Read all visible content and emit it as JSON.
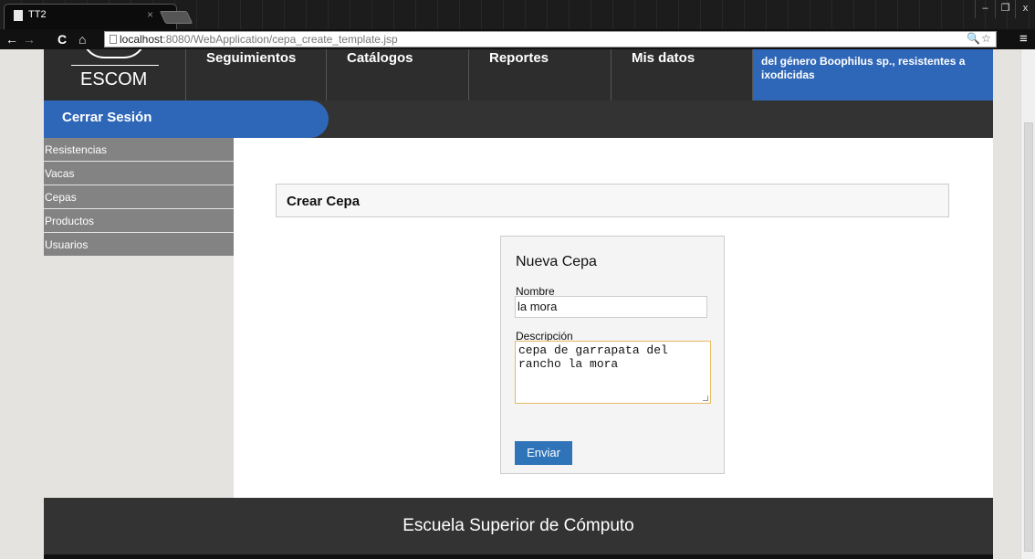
{
  "browser": {
    "tab_title": "TT2",
    "tab_close": "×",
    "url_host": "localhost",
    "url_path": ":8080/WebApplication/cepa_create_template.jsp",
    "back_icon": "←",
    "forward_icon": "→",
    "reload_icon": "C",
    "home_icon": "⌂",
    "zoom_icon": "🔍",
    "star_icon": "☆",
    "menu_icon": "≡",
    "minimize": "–",
    "restore": "❐",
    "close": "x"
  },
  "header": {
    "logo_text": "ESCOM",
    "menu": [
      "Seguimientos",
      "Catálogos",
      "Reportes",
      "Mis datos"
    ],
    "title": "del género Boophilus sp., resistentes a ixodicidas"
  },
  "subbar": {
    "logout_label": "Cerrar Sesión"
  },
  "sidebar": {
    "items": [
      "Resistencias",
      "Vacas",
      "Cepas",
      "Productos",
      "Usuarios"
    ]
  },
  "content": {
    "section_title": "Crear Cepa",
    "form": {
      "title": "Nueva Cepa",
      "nombre_label": "Nombre",
      "nombre_value": "la mora",
      "descripcion_label": "Descripción",
      "descripcion_value": "cepa de garrapata del rancho la mora",
      "submit_label": "Enviar"
    }
  },
  "footer": {
    "text": "Escuela Superior de Cómputo"
  },
  "colors": {
    "accent_blue": "#2f67b8",
    "dark_bar": "#333333",
    "sidebar_item": "#838383",
    "textarea_focus": "#e8b964"
  }
}
